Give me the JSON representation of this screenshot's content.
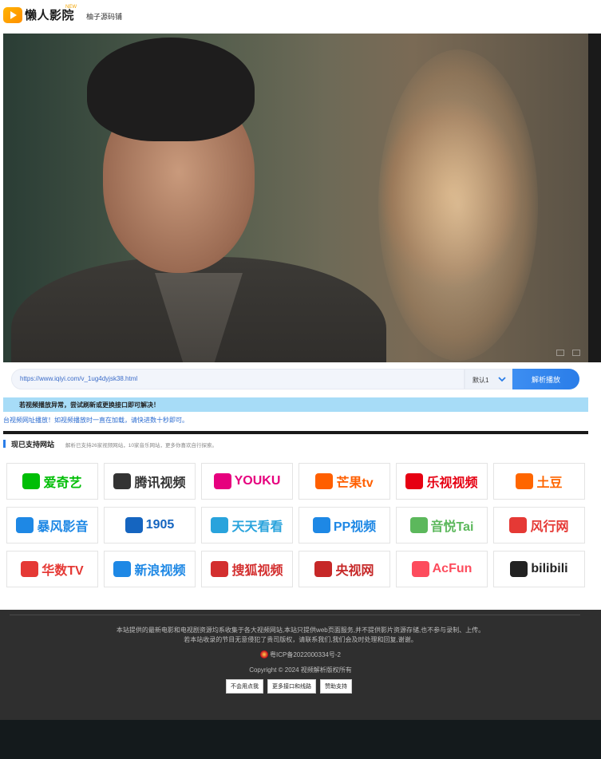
{
  "header": {
    "brand": "懒人影院",
    "brand_tag": "NEW",
    "link": "柚子源码铺"
  },
  "player": {
    "play_icon": "play-icon"
  },
  "parser": {
    "url_value": "https://www.iqiyi.com/v_1ug4dyjsk38.html",
    "api_selected": "默认1",
    "parse_button": "解析播放",
    "notice": "若视频播放异常，尝试刷新或更换接口即可解决！",
    "tip": "台视频网址播放！如视频播放时一直在加载，请快进数十秒即可。"
  },
  "sites_section": {
    "title": "现已支持网站",
    "subtitle": "解析已支持26家视频网站，10家音乐网站，更多你喜欢自行探索。",
    "sites": [
      {
        "name": "爱奇艺",
        "color": "#00be06"
      },
      {
        "name": "腾讯视频",
        "color": "#333333"
      },
      {
        "name": "YOUKU",
        "color": "#e6007e"
      },
      {
        "name": "芒果tv",
        "color": "#ff5f00"
      },
      {
        "name": "乐视视频",
        "color": "#e60012"
      },
      {
        "name": "土豆",
        "color": "#ff6600"
      },
      {
        "name": "暴风影音",
        "color": "#1e88e5"
      },
      {
        "name": "1905",
        "color": "#1565c0"
      },
      {
        "name": "天天看看",
        "color": "#29a3dc"
      },
      {
        "name": "PP视频",
        "color": "#1e88e5"
      },
      {
        "name": "音悦Tai",
        "color": "#5cb85c"
      },
      {
        "name": "风行网",
        "color": "#e53935"
      },
      {
        "name": "华数TV",
        "color": "#e53935"
      },
      {
        "name": "新浪视频",
        "color": "#1e88e5"
      },
      {
        "name": "搜狐视频",
        "color": "#d32f2f"
      },
      {
        "name": "央视网",
        "color": "#c62828"
      },
      {
        "name": "AcFun",
        "color": "#fd4c5d"
      },
      {
        "name": "bilibili",
        "color": "#222222"
      }
    ]
  },
  "footer": {
    "line1": "本站提供的最新电影和电视剧资源均系收集于各大视频网站,本站只提供web页面服务,并不提供影片资源存储,也不参与录制、上传。",
    "line2": "若本站收录的节目无意侵犯了贵司版权，请联系我们,我们会及时处理和回复,谢谢。",
    "icp": "粤ICP备2022000334号-2",
    "copyright": "Copyright © 2024  视频解析版权所有",
    "buttons": [
      "不会用点我",
      "更多接口和线路",
      "赞助支持"
    ]
  }
}
